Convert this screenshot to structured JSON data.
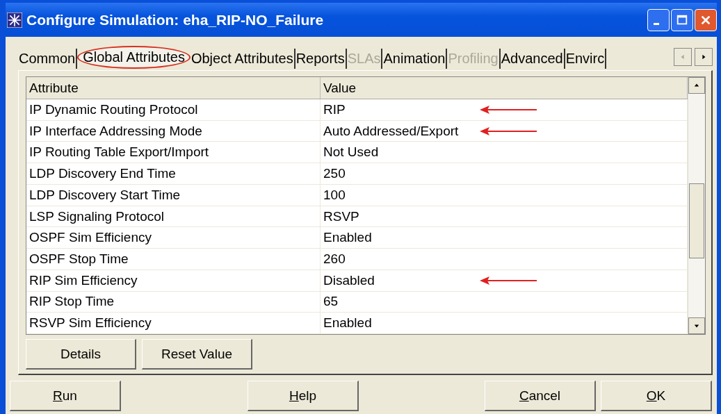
{
  "window": {
    "title": "Configure Simulation: eha_RIP-NO_Failure"
  },
  "tabs": [
    {
      "label": "Common",
      "selected": false,
      "disabled": false,
      "circled": false
    },
    {
      "label": "Global Attributes",
      "selected": true,
      "disabled": false,
      "circled": true
    },
    {
      "label": "Object Attributes",
      "selected": false,
      "disabled": false,
      "circled": false
    },
    {
      "label": "Reports",
      "selected": false,
      "disabled": false,
      "circled": false
    },
    {
      "label": "SLAs",
      "selected": false,
      "disabled": true,
      "circled": false
    },
    {
      "label": "Animation",
      "selected": false,
      "disabled": false,
      "circled": false
    },
    {
      "label": "Profiling",
      "selected": false,
      "disabled": true,
      "circled": false
    },
    {
      "label": "Advanced",
      "selected": false,
      "disabled": false,
      "circled": false
    },
    {
      "label": "Envirc",
      "selected": false,
      "disabled": false,
      "circled": false
    }
  ],
  "table": {
    "columns": [
      "Attribute",
      "Value"
    ],
    "rows": [
      {
        "attribute": "IP Dynamic Routing Protocol",
        "value": "RIP",
        "arrow": true
      },
      {
        "attribute": "IP Interface Addressing Mode",
        "value": "Auto Addressed/Export",
        "arrow": true
      },
      {
        "attribute": "IP Routing Table Export/Import",
        "value": "Not Used",
        "arrow": false
      },
      {
        "attribute": "LDP Discovery End Time",
        "value": "250",
        "arrow": false
      },
      {
        "attribute": "LDP Discovery Start Time",
        "value": "100",
        "arrow": false
      },
      {
        "attribute": "LSP Signaling Protocol",
        "value": "RSVP",
        "arrow": false
      },
      {
        "attribute": "OSPF Sim Efficiency",
        "value": "Enabled",
        "arrow": false
      },
      {
        "attribute": "OSPF Stop Time",
        "value": "260",
        "arrow": false
      },
      {
        "attribute": "RIP Sim Efficiency",
        "value": "Disabled",
        "arrow": true
      },
      {
        "attribute": "RIP Stop Time",
        "value": "65",
        "arrow": false
      },
      {
        "attribute": "RSVP Sim Efficiency",
        "value": "Enabled",
        "arrow": false
      }
    ]
  },
  "table_buttons": [
    "Details",
    "Reset Value"
  ],
  "footer_buttons": [
    "Run",
    "Help",
    "Cancel",
    "OK"
  ]
}
